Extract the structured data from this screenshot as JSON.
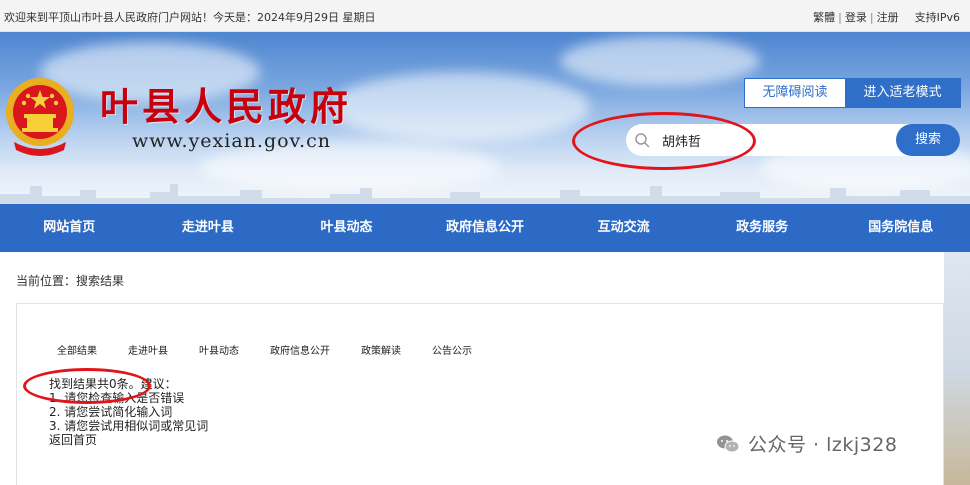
{
  "topbar": {
    "welcome": "欢迎来到平顶山市叶县人民政府门户网站！今天是：2024年9月29日 星期日",
    "links": {
      "traditional": "繁體",
      "login": "登录",
      "register": "注册",
      "ipv6": "支持IPv6"
    }
  },
  "header": {
    "site_title": "叶县人民政府",
    "site_url": "www.yexian.gov.cn",
    "accessibility_label": "无障碍阅读",
    "elder_mode_label": "进入适老模式",
    "search": {
      "value": "胡炜哲",
      "button_label": "搜索"
    }
  },
  "nav": {
    "items": [
      "网站首页",
      "走进叶县",
      "叶县动态",
      "政府信息公开",
      "互动交流",
      "政务服务",
      "国务院信息"
    ]
  },
  "breadcrumb": "当前位置：搜索结果",
  "results": {
    "tabs": [
      "全部结果",
      "走进叶县",
      "叶县动态",
      "政府信息公开",
      "政策解读",
      "公告公示"
    ],
    "summary": "找到结果共0条。建议：",
    "suggestions": [
      "1. 请您检查输入是否错误",
      "2. 请您尝试简化输入词",
      "3. 请您尝试用相似词或常见词"
    ],
    "home_link": "返回首页"
  },
  "watermark": {
    "text": "公众号 · lzkj328"
  },
  "colors": {
    "brand_blue": "#2c6ac6",
    "title_red": "#c8000c",
    "annotation_red": "#e0141b"
  }
}
